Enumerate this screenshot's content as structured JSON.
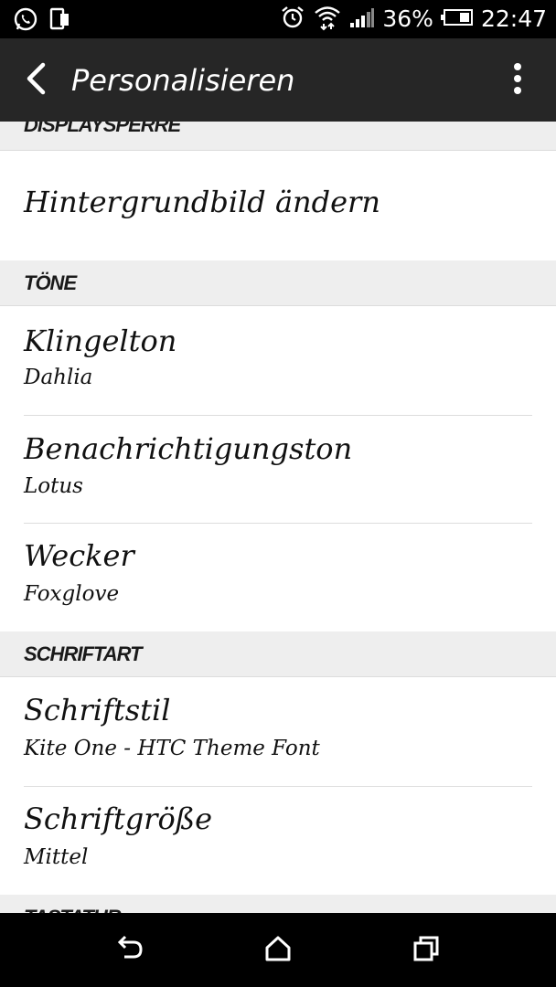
{
  "status_bar": {
    "battery_percent": "36%",
    "time": "22:47",
    "icons": [
      "whatsapp-icon",
      "phone-device-icon",
      "alarm-icon",
      "wifi-icon",
      "signal-icon",
      "battery-icon"
    ]
  },
  "action_bar": {
    "title": "Personalisieren",
    "back_icon": "chevron-left-icon",
    "overflow_icon": "more-vert-icon"
  },
  "sections": {
    "displaysperre": "DISPLAYSPERRE",
    "toene": "TÖNE",
    "schriftart": "SCHRIFTART",
    "tastatur": "TASTATUR"
  },
  "items": {
    "hintergrund": {
      "title": "Hintergrundbild ändern"
    },
    "klingelton": {
      "title": "Klingelton",
      "value": "Dahlia"
    },
    "benachrichtigungston": {
      "title": "Benachrichtigungston",
      "value": "Lotus"
    },
    "wecker": {
      "title": "Wecker",
      "value": "Foxglove"
    },
    "schriftstil": {
      "title": "Schriftstil",
      "value": "Kite One - HTC Theme Font"
    },
    "schriftgroesse": {
      "title": "Schriftgröße",
      "value": "Mittel"
    }
  },
  "nav_bar": {
    "icons": [
      "back-nav-icon",
      "home-nav-icon",
      "recents-nav-icon"
    ]
  }
}
